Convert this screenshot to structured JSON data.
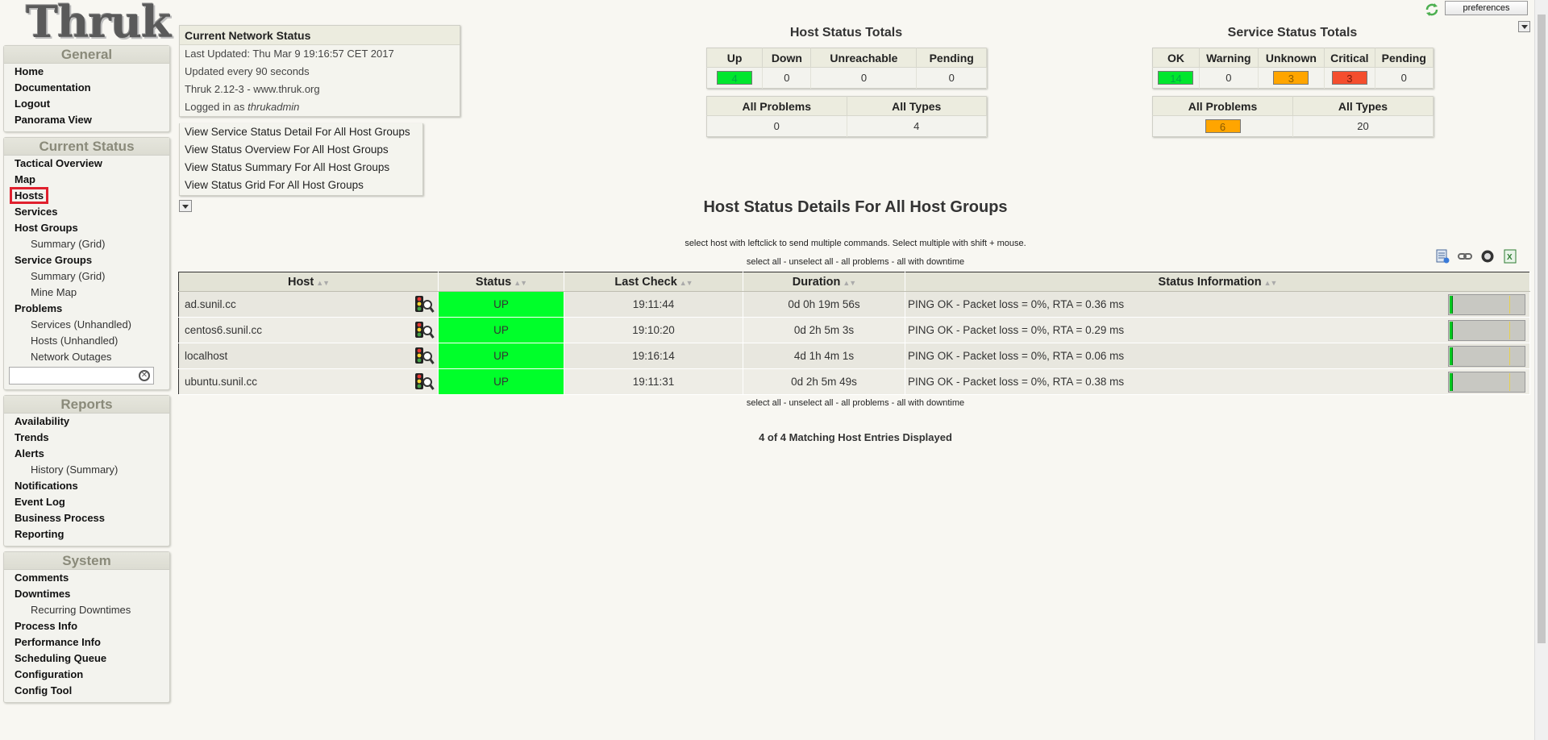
{
  "app": {
    "logo": "Thruk",
    "preferences_label": "preferences"
  },
  "sidebar": {
    "general": {
      "title": "General",
      "items": [
        {
          "label": "Home"
        },
        {
          "label": "Documentation"
        },
        {
          "label": "Logout"
        },
        {
          "label": "Panorama View"
        }
      ]
    },
    "current_status": {
      "title": "Current Status",
      "items": [
        {
          "label": "Tactical Overview",
          "sub": false
        },
        {
          "label": "Map",
          "sub": false
        },
        {
          "label": "Hosts",
          "sub": false,
          "active": true
        },
        {
          "label": "Services",
          "sub": false
        },
        {
          "label": "Host Groups",
          "sub": false
        },
        {
          "label": "Summary (Grid)",
          "sub": true
        },
        {
          "label": "Service Groups",
          "sub": false
        },
        {
          "label": "Summary (Grid)",
          "sub": true
        },
        {
          "label": "Mine Map",
          "sub": true
        },
        {
          "label": "Problems",
          "sub": false
        },
        {
          "label": "Services (Unhandled)",
          "sub": true
        },
        {
          "label": "Hosts (Unhandled)",
          "sub": true
        },
        {
          "label": "Network Outages",
          "sub": true
        }
      ],
      "search_value": ""
    },
    "reports": {
      "title": "Reports",
      "items": [
        {
          "label": "Availability",
          "sub": false
        },
        {
          "label": "Trends",
          "sub": false
        },
        {
          "label": "Alerts",
          "sub": false
        },
        {
          "label": "History (Summary)",
          "sub": true
        },
        {
          "label": "Notifications",
          "sub": false
        },
        {
          "label": "Event Log",
          "sub": false
        },
        {
          "label": "Business Process",
          "sub": false
        },
        {
          "label": "Reporting",
          "sub": false
        }
      ]
    },
    "system": {
      "title": "System",
      "items": [
        {
          "label": "Comments",
          "sub": false
        },
        {
          "label": "Downtimes",
          "sub": false
        },
        {
          "label": "Recurring Downtimes",
          "sub": true
        },
        {
          "label": "Process Info",
          "sub": false
        },
        {
          "label": "Performance Info",
          "sub": false
        },
        {
          "label": "Scheduling Queue",
          "sub": false
        },
        {
          "label": "Configuration",
          "sub": false
        },
        {
          "label": "Config Tool",
          "sub": false
        }
      ]
    }
  },
  "network_status": {
    "title": "Current Network Status",
    "last_updated": "Last Updated: Thu Mar 9 19:16:57 CET 2017",
    "update_interval": "Updated every 90 seconds",
    "version": "Thruk 2.12-3 - www.thruk.org",
    "logged_in_prefix": "Logged in as ",
    "logged_in_user": "thrukadmin"
  },
  "view_links": [
    "View Service Status Detail For All Host Groups",
    "View Status Overview For All Host Groups",
    "View Status Summary For All Host Groups",
    "View Status Grid For All Host Groups"
  ],
  "host_totals": {
    "title": "Host Status Totals",
    "headers": [
      "Up",
      "Down",
      "Unreachable",
      "Pending"
    ],
    "values": [
      "4",
      "0",
      "0",
      "0"
    ],
    "problems_headers": [
      "All Problems",
      "All Types"
    ],
    "problems_values": [
      "0",
      "4"
    ]
  },
  "service_totals": {
    "title": "Service Status Totals",
    "headers": [
      "OK",
      "Warning",
      "Unknown",
      "Critical",
      "Pending"
    ],
    "values": [
      "14",
      "0",
      "3",
      "3",
      "0"
    ],
    "problems_headers": [
      "All Problems",
      "All Types"
    ],
    "problems_values": [
      "6",
      "20"
    ]
  },
  "main": {
    "title": "Host Status Details For All Host Groups",
    "hint": "select host with leftclick to send multiple commands. Select multiple with shift + mouse.",
    "select_all": "select all",
    "unselect_all": "unselect all",
    "all_problems": "all problems",
    "all_with_downtime": "all with downtime",
    "columns": [
      "Host",
      "Status",
      "Last Check",
      "Duration",
      "Status Information"
    ],
    "rows": [
      {
        "host": "ad.sunil.cc",
        "status": "UP",
        "last_check": "19:11:44",
        "duration": "0d 0h 19m 56s",
        "info": "PING OK - Packet loss = 0%, RTA = 0.36 ms",
        "rta_fraction": 0.04
      },
      {
        "host": "centos6.sunil.cc",
        "status": "UP",
        "last_check": "19:10:20",
        "duration": "0d 2h 5m 3s",
        "info": "PING OK - Packet loss = 0%, RTA = 0.29 ms",
        "rta_fraction": 0.04
      },
      {
        "host": "localhost",
        "status": "UP",
        "last_check": "19:16:14",
        "duration": "4d 1h 4m 1s",
        "info": "PING OK - Packet loss = 0%, RTA = 0.06 ms",
        "rta_fraction": 0.04
      },
      {
        "host": "ubuntu.sunil.cc",
        "status": "UP",
        "last_check": "19:11:31",
        "duration": "0d 2h 5m 49s",
        "info": "PING OK - Packet loss = 0%, RTA = 0.38 ms",
        "rta_fraction": 0.04
      }
    ],
    "matching": "4 of 4 Matching Host Entries Displayed"
  },
  "colors": {
    "up": "#00ff2a",
    "ok": "#00e62e",
    "unknown": "#ffa500",
    "critical": "#f44e2e",
    "highlight": "#e0202e"
  }
}
